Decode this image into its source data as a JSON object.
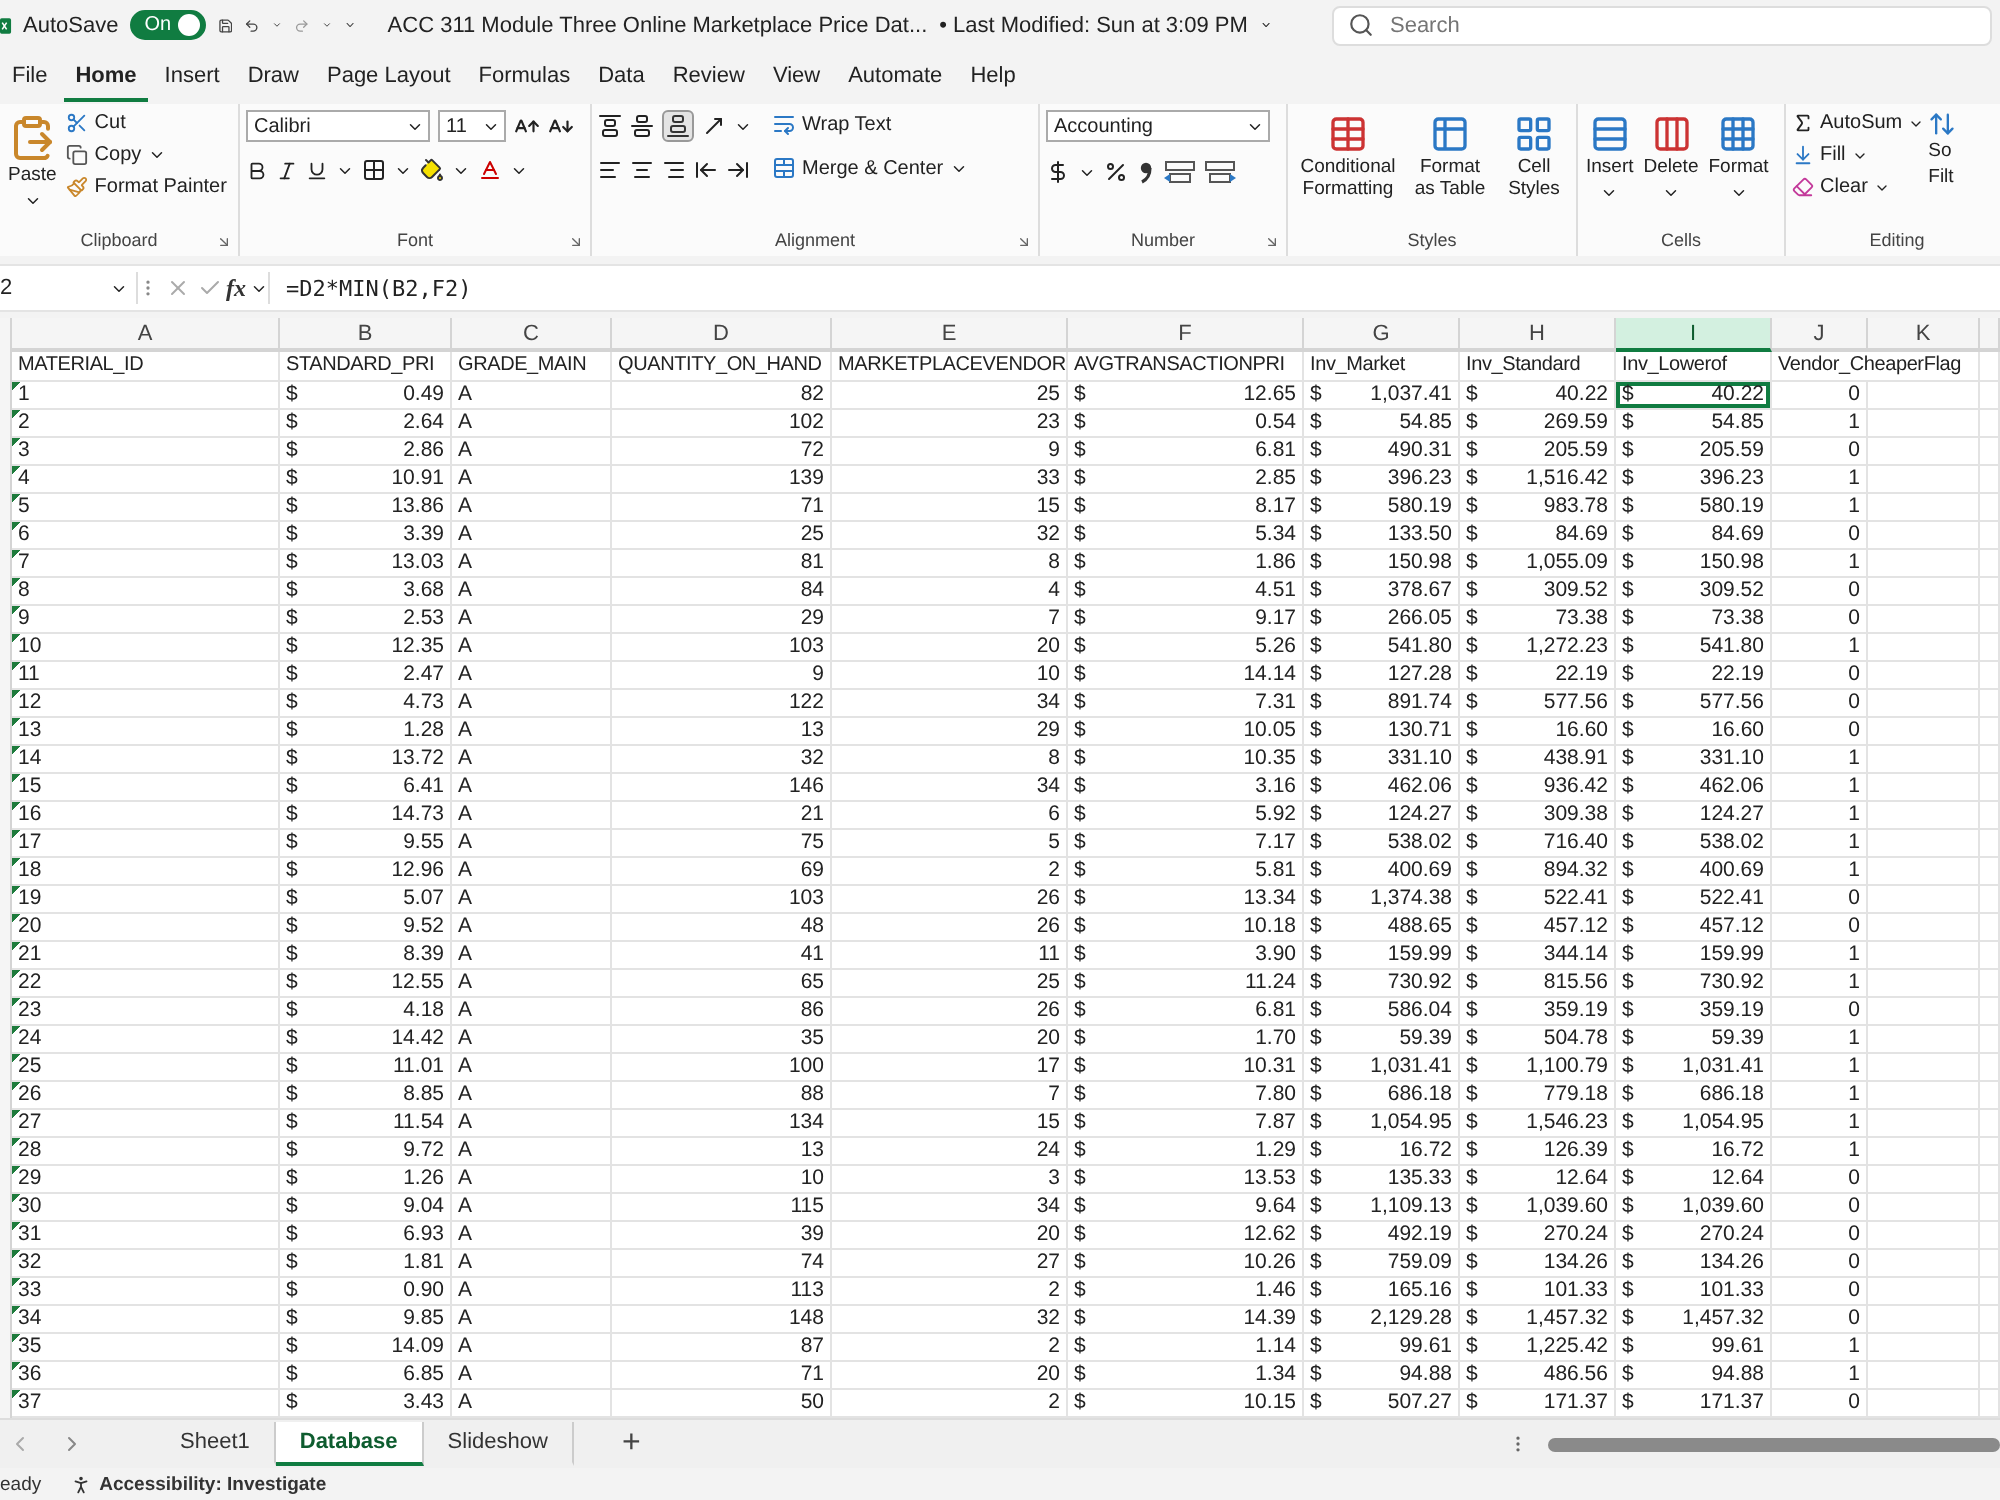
{
  "title_bar": {
    "autosave_label": "AutoSave",
    "autosave": {
      "on": true,
      "label": "On"
    },
    "title": "ACC 311 Module Three Online Marketplace Price Dat...",
    "last_modified": "• Last Modified: Sun at 3:09 PM",
    "search": {
      "placeholder": "Search"
    }
  },
  "menu_tabs": [
    {
      "label": "File",
      "selected": false
    },
    {
      "label": "Home",
      "selected": true
    },
    {
      "label": "Insert",
      "selected": false
    },
    {
      "label": "Draw",
      "selected": false
    },
    {
      "label": "Page Layout",
      "selected": false
    },
    {
      "label": "Formulas",
      "selected": false
    },
    {
      "label": "Data",
      "selected": false
    },
    {
      "label": "Review",
      "selected": false
    },
    {
      "label": "View",
      "selected": false
    },
    {
      "label": "Automate",
      "selected": false
    },
    {
      "label": "Help",
      "selected": false
    }
  ],
  "ribbon": {
    "clipboard": {
      "label": "Clipboard",
      "paste": "Paste",
      "cut": "Cut",
      "copy": "Copy",
      "format_painter": "Format Painter"
    },
    "font": {
      "label": "Font",
      "font_name": "Calibri",
      "font_size": "11"
    },
    "alignment": {
      "label": "Alignment",
      "wrap_text": "Wrap Text",
      "merge_center": "Merge & Center"
    },
    "number": {
      "label": "Number",
      "format": "Accounting"
    },
    "styles": {
      "label": "Styles",
      "conditional_formatting": "Conditional Formatting",
      "format_as_table": "Format as Table",
      "cell_styles": "Cell Styles"
    },
    "cells": {
      "label": "Cells",
      "insert": "Insert",
      "delete": "Delete",
      "format": "Format"
    },
    "editing": {
      "label": "Editing",
      "autosum": "AutoSum",
      "fill": "Fill",
      "clear": "Clear",
      "sort_filter_lines": [
        "So",
        "Filt"
      ]
    }
  },
  "formula_bar": {
    "name_box": "2",
    "function_button": "fx",
    "formula": "=D2*MIN(B2,F2)"
  },
  "sheet": {
    "columns": [
      {
        "letter": "A",
        "header": "MATERIAL_ID",
        "kind": "text_number",
        "selected": false
      },
      {
        "letter": "B",
        "header": "STANDARD_PRI",
        "kind": "currency",
        "selected": false
      },
      {
        "letter": "C",
        "header": "GRADE_MAIN",
        "kind": "text",
        "selected": false
      },
      {
        "letter": "D",
        "header": "QUANTITY_ON_HAND",
        "kind": "number",
        "selected": false
      },
      {
        "letter": "E",
        "header": "MARKETPLACEVENDOR",
        "kind": "number",
        "selected": false
      },
      {
        "letter": "F",
        "header": "AVGTRANSACTIONPRI",
        "kind": "currency",
        "selected": false
      },
      {
        "letter": "G",
        "header": "Inv_Market",
        "kind": "currency",
        "selected": false
      },
      {
        "letter": "H",
        "header": "Inv_Standard",
        "kind": "currency",
        "selected": false
      },
      {
        "letter": "I",
        "header": "Inv_Lowerof",
        "kind": "currency",
        "selected": true
      },
      {
        "letter": "J",
        "header": "Vendor_CheaperFlag",
        "kind": "number",
        "selected": false
      },
      {
        "letter": "K",
        "kind": "number",
        "selected": false
      }
    ],
    "rows": [
      {
        "selected": true,
        "cells": [
          "1",
          "$ 0.49",
          "A",
          "82",
          "25",
          "$ 12.65",
          "$ 1,037.41",
          "$ 40.22",
          "$ 40.22",
          "0"
        ]
      },
      {
        "selected": false,
        "cells": [
          "2",
          "$ 2.64",
          "A",
          "102",
          "23",
          "$ 0.54",
          "$ 54.85",
          "$ 269.59",
          "$ 54.85",
          "1"
        ]
      },
      {
        "selected": false,
        "cells": [
          "3",
          "$ 2.86",
          "A",
          "72",
          "9",
          "$ 6.81",
          "$ 490.31",
          "$ 205.59",
          "$ 205.59",
          "0"
        ]
      },
      {
        "selected": false,
        "cells": [
          "4",
          "$ 10.91",
          "A",
          "139",
          "33",
          "$ 2.85",
          "$ 396.23",
          "$ 1,516.42",
          "$ 396.23",
          "1"
        ]
      },
      {
        "selected": false,
        "cells": [
          "5",
          "$ 13.86",
          "A",
          "71",
          "15",
          "$ 8.17",
          "$ 580.19",
          "$ 983.78",
          "$ 580.19",
          "1"
        ]
      },
      {
        "selected": false,
        "cells": [
          "6",
          "$ 3.39",
          "A",
          "25",
          "32",
          "$ 5.34",
          "$ 133.50",
          "$ 84.69",
          "$ 84.69",
          "0"
        ]
      },
      {
        "selected": false,
        "cells": [
          "7",
          "$ 13.03",
          "A",
          "81",
          "8",
          "$ 1.86",
          "$ 150.98",
          "$ 1,055.09",
          "$ 150.98",
          "1"
        ]
      },
      {
        "selected": false,
        "cells": [
          "8",
          "$ 3.68",
          "A",
          "84",
          "4",
          "$ 4.51",
          "$ 378.67",
          "$ 309.52",
          "$ 309.52",
          "0"
        ]
      },
      {
        "selected": false,
        "cells": [
          "9",
          "$ 2.53",
          "A",
          "29",
          "7",
          "$ 9.17",
          "$ 266.05",
          "$ 73.38",
          "$ 73.38",
          "0"
        ]
      },
      {
        "selected": false,
        "cells": [
          "10",
          "$ 12.35",
          "A",
          "103",
          "20",
          "$ 5.26",
          "$ 541.80",
          "$ 1,272.23",
          "$ 541.80",
          "1"
        ]
      },
      {
        "selected": false,
        "cells": [
          "11",
          "$ 2.47",
          "A",
          "9",
          "10",
          "$ 14.14",
          "$ 127.28",
          "$ 22.19",
          "$ 22.19",
          "0"
        ]
      },
      {
        "selected": false,
        "cells": [
          "12",
          "$ 4.73",
          "A",
          "122",
          "34",
          "$ 7.31",
          "$ 891.74",
          "$ 577.56",
          "$ 577.56",
          "0"
        ]
      },
      {
        "selected": false,
        "cells": [
          "13",
          "$ 1.28",
          "A",
          "13",
          "29",
          "$ 10.05",
          "$ 130.71",
          "$ 16.60",
          "$ 16.60",
          "0"
        ]
      },
      {
        "selected": false,
        "cells": [
          "14",
          "$ 13.72",
          "A",
          "32",
          "8",
          "$ 10.35",
          "$ 331.10",
          "$ 438.91",
          "$ 331.10",
          "1"
        ]
      },
      {
        "selected": false,
        "cells": [
          "15",
          "$ 6.41",
          "A",
          "146",
          "34",
          "$ 3.16",
          "$ 462.06",
          "$ 936.42",
          "$ 462.06",
          "1"
        ]
      },
      {
        "selected": false,
        "cells": [
          "16",
          "$ 14.73",
          "A",
          "21",
          "6",
          "$ 5.92",
          "$ 124.27",
          "$ 309.38",
          "$ 124.27",
          "1"
        ]
      },
      {
        "selected": false,
        "cells": [
          "17",
          "$ 9.55",
          "A",
          "75",
          "5",
          "$ 7.17",
          "$ 538.02",
          "$ 716.40",
          "$ 538.02",
          "1"
        ]
      },
      {
        "selected": false,
        "cells": [
          "18",
          "$ 12.96",
          "A",
          "69",
          "2",
          "$ 5.81",
          "$ 400.69",
          "$ 894.32",
          "$ 400.69",
          "1"
        ]
      },
      {
        "selected": false,
        "cells": [
          "19",
          "$ 5.07",
          "A",
          "103",
          "26",
          "$ 13.34",
          "$ 1,374.38",
          "$ 522.41",
          "$ 522.41",
          "0"
        ]
      },
      {
        "selected": false,
        "cells": [
          "20",
          "$ 9.52",
          "A",
          "48",
          "26",
          "$ 10.18",
          "$ 488.65",
          "$ 457.12",
          "$ 457.12",
          "0"
        ]
      },
      {
        "selected": false,
        "cells": [
          "21",
          "$ 8.39",
          "A",
          "41",
          "11",
          "$ 3.90",
          "$ 159.99",
          "$ 344.14",
          "$ 159.99",
          "1"
        ]
      },
      {
        "selected": false,
        "cells": [
          "22",
          "$ 12.55",
          "A",
          "65",
          "25",
          "$ 11.24",
          "$ 730.92",
          "$ 815.56",
          "$ 730.92",
          "1"
        ]
      },
      {
        "selected": false,
        "cells": [
          "23",
          "$ 4.18",
          "A",
          "86",
          "26",
          "$ 6.81",
          "$ 586.04",
          "$ 359.19",
          "$ 359.19",
          "0"
        ]
      },
      {
        "selected": false,
        "cells": [
          "24",
          "$ 14.42",
          "A",
          "35",
          "20",
          "$ 1.70",
          "$ 59.39",
          "$ 504.78",
          "$ 59.39",
          "1"
        ]
      },
      {
        "selected": false,
        "cells": [
          "25",
          "$ 11.01",
          "A",
          "100",
          "17",
          "$ 10.31",
          "$ 1,031.41",
          "$ 1,100.79",
          "$ 1,031.41",
          "1"
        ]
      },
      {
        "selected": false,
        "cells": [
          "26",
          "$ 8.85",
          "A",
          "88",
          "7",
          "$ 7.80",
          "$ 686.18",
          "$ 779.18",
          "$ 686.18",
          "1"
        ]
      },
      {
        "selected": false,
        "cells": [
          "27",
          "$ 11.54",
          "A",
          "134",
          "15",
          "$ 7.87",
          "$ 1,054.95",
          "$ 1,546.23",
          "$ 1,054.95",
          "1"
        ]
      },
      {
        "selected": false,
        "cells": [
          "28",
          "$ 9.72",
          "A",
          "13",
          "24",
          "$ 1.29",
          "$ 16.72",
          "$ 126.39",
          "$ 16.72",
          "1"
        ]
      },
      {
        "selected": false,
        "cells": [
          "29",
          "$ 1.26",
          "A",
          "10",
          "3",
          "$ 13.53",
          "$ 135.33",
          "$ 12.64",
          "$ 12.64",
          "0"
        ]
      },
      {
        "selected": false,
        "cells": [
          "30",
          "$ 9.04",
          "A",
          "115",
          "34",
          "$ 9.64",
          "$ 1,109.13",
          "$ 1,039.60",
          "$ 1,039.60",
          "0"
        ]
      },
      {
        "selected": false,
        "cells": [
          "31",
          "$ 6.93",
          "A",
          "39",
          "20",
          "$ 12.62",
          "$ 492.19",
          "$ 270.24",
          "$ 270.24",
          "0"
        ]
      },
      {
        "selected": false,
        "cells": [
          "32",
          "$ 1.81",
          "A",
          "74",
          "27",
          "$ 10.26",
          "$ 759.09",
          "$ 134.26",
          "$ 134.26",
          "0"
        ]
      },
      {
        "selected": false,
        "cells": [
          "33",
          "$ 0.90",
          "A",
          "113",
          "2",
          "$ 1.46",
          "$ 165.16",
          "$ 101.33",
          "$ 101.33",
          "0"
        ]
      },
      {
        "selected": false,
        "cells": [
          "34",
          "$ 9.85",
          "A",
          "148",
          "32",
          "$ 14.39",
          "$ 2,129.28",
          "$ 1,457.32",
          "$ 1,457.32",
          "0"
        ]
      },
      {
        "selected": false,
        "cells": [
          "35",
          "$ 14.09",
          "A",
          "87",
          "2",
          "$ 1.14",
          "$ 99.61",
          "$ 1,225.42",
          "$ 99.61",
          "1"
        ]
      },
      {
        "selected": false,
        "cells": [
          "36",
          "$ 6.85",
          "A",
          "71",
          "20",
          "$ 1.34",
          "$ 94.88",
          "$ 486.56",
          "$ 94.88",
          "1"
        ]
      },
      {
        "selected": false,
        "cells": [
          "37",
          "$ 3.43",
          "A",
          "50",
          "2",
          "$ 10.15",
          "$ 507.27",
          "$ 171.37",
          "$ 171.37",
          "0"
        ]
      }
    ]
  },
  "sheet_tabs": [
    {
      "label": "Sheet1",
      "selected": false
    },
    {
      "label": "Database",
      "selected": true
    },
    {
      "label": "Slideshow",
      "selected": false
    }
  ],
  "add_sheet": "+",
  "status_bar": {
    "ready": "eady",
    "accessibility": "Accessibility: Investigate"
  }
}
